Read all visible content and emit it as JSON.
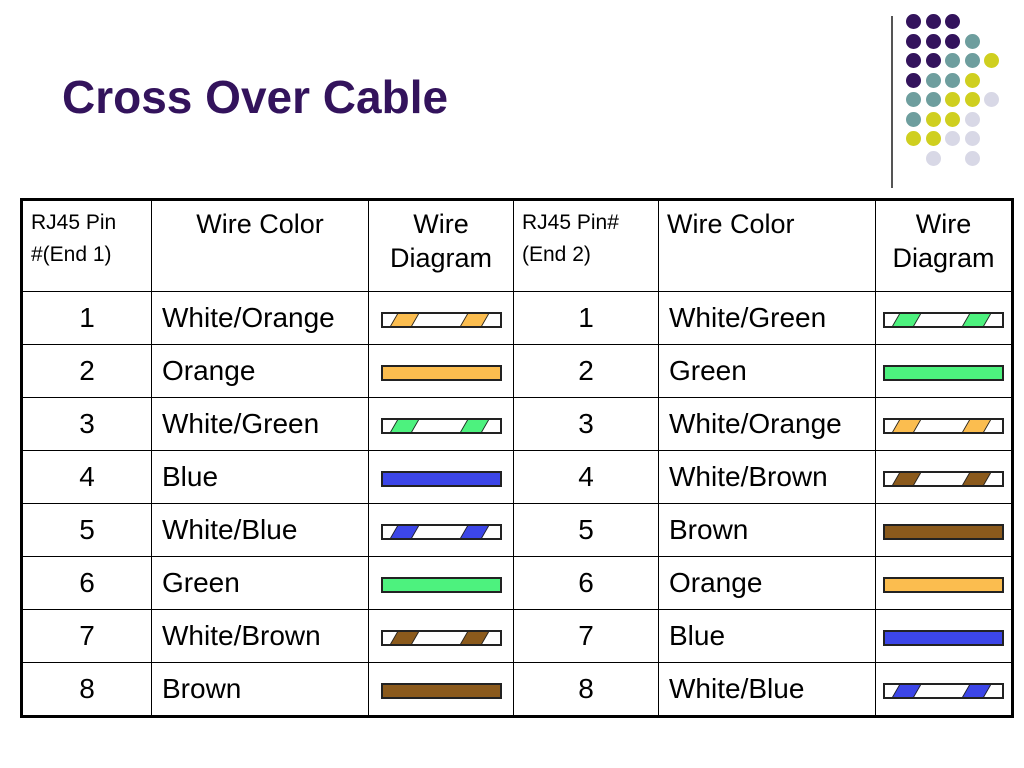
{
  "title": "Cross Over Cable",
  "colors": {
    "orange": "#fbbd4f",
    "green": "#4df27e",
    "blue": "#3c46e8",
    "brown": "#8b5a1c"
  },
  "table": {
    "headers": [
      {
        "line1": "RJ45 Pin",
        "line2": "#(End 1)"
      },
      {
        "line1": "Wire Color",
        "line2": ""
      },
      {
        "line1": "Wire",
        "line2": "Diagram"
      },
      {
        "line1": "RJ45 Pin#",
        "line2": "(End 2)"
      },
      {
        "line1": "Wire Color",
        "line2": ""
      },
      {
        "line1": "Wire",
        "line2": "Diagram"
      }
    ],
    "rows": [
      {
        "pin1": "1",
        "color1": "White/Orange",
        "wire1": {
          "base": "orange",
          "striped": true
        },
        "pin2": "1",
        "color2": "White/Green",
        "wire2": {
          "base": "green",
          "striped": true
        }
      },
      {
        "pin1": "2",
        "color1": "Orange",
        "wire1": {
          "base": "orange",
          "striped": false
        },
        "pin2": "2",
        "color2": "Green",
        "wire2": {
          "base": "green",
          "striped": false
        }
      },
      {
        "pin1": "3",
        "color1": "White/Green",
        "wire1": {
          "base": "green",
          "striped": true
        },
        "pin2": "3",
        "color2": "White/Orange",
        "wire2": {
          "base": "orange",
          "striped": true
        }
      },
      {
        "pin1": "4",
        "color1": "Blue",
        "wire1": {
          "base": "blue",
          "striped": false
        },
        "pin2": "4",
        "color2": "White/Brown",
        "wire2": {
          "base": "brown",
          "striped": true
        }
      },
      {
        "pin1": "5",
        "color1": "White/Blue",
        "wire1": {
          "base": "blue",
          "striped": true
        },
        "pin2": "5",
        "color2": "Brown",
        "wire2": {
          "base": "brown",
          "striped": false
        }
      },
      {
        "pin1": "6",
        "color1": "Green",
        "wire1": {
          "base": "green",
          "striped": false
        },
        "pin2": "6",
        "color2": "Orange",
        "wire2": {
          "base": "orange",
          "striped": false
        }
      },
      {
        "pin1": "7",
        "color1": "White/Brown",
        "wire1": {
          "base": "brown",
          "striped": true
        },
        "pin2": "7",
        "color2": "Blue",
        "wire2": {
          "base": "blue",
          "striped": false
        }
      },
      {
        "pin1": "8",
        "color1": "Brown",
        "wire1": {
          "base": "brown",
          "striped": false
        },
        "pin2": "8",
        "color2": "White/Blue",
        "wire2": {
          "base": "blue",
          "striped": true
        }
      }
    ]
  },
  "decoration": {
    "palette": {
      "p": "#33135c",
      "t": "#6e9e9e",
      "y": "#cfcf1f",
      "l": "#d8d8e6"
    },
    "grid": [
      "ppp..",
      "pppt.",
      "ppttY",
      "ptty.",
      "ttyyl",
      "tyyl.",
      "yyll.",
      ".l.l."
    ]
  }
}
